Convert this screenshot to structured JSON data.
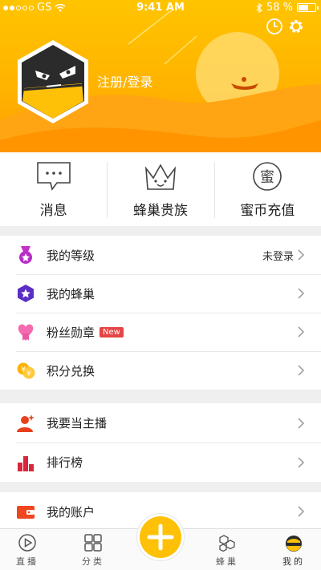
{
  "status_bar": {
    "carrier": "GS",
    "time": "9:41 AM",
    "battery": "58 %",
    "battery_level": 0.58
  },
  "header": {
    "login_label": "注册/登录",
    "icons": [
      "clock-icon",
      "gear-icon"
    ]
  },
  "actions": [
    {
      "label": "消息",
      "icon": "chat-bubble-icon"
    },
    {
      "label": "蜂巢贵族",
      "icon": "crown-icon"
    },
    {
      "label": "蜜币充值",
      "icon": "honey-coin-icon",
      "icon_text": "蜜"
    }
  ],
  "menu_groups": [
    [
      {
        "label": "我的等级",
        "icon": "level-medal-icon",
        "value": "未登录"
      },
      {
        "label": "我的蜂巢",
        "icon": "hive-star-icon"
      },
      {
        "label": "粉丝勋章",
        "icon": "fan-badge-icon",
        "badge": "New"
      },
      {
        "label": "积分兑换",
        "icon": "points-coins-icon",
        "icon_text": "¥"
      }
    ],
    [
      {
        "label": "我要当主播",
        "icon": "streamer-icon"
      },
      {
        "label": "排行榜",
        "icon": "ranking-icon"
      }
    ],
    [
      {
        "label": "我的账户",
        "icon": "wallet-icon"
      }
    ]
  ],
  "tabbar": {
    "tabs": [
      {
        "label": "直播",
        "icon": "live-play-icon"
      },
      {
        "label": "分类",
        "icon": "category-grid-icon"
      },
      {
        "label": "蜂巢",
        "icon": "hive-tab-icon"
      },
      {
        "label": "我的",
        "icon": "profile-bee-icon",
        "active": true
      }
    ],
    "center_icon": "plus-icon"
  },
  "colors": {
    "accent": "#ffc107",
    "header_top": "#ffc400",
    "header_bottom": "#ff9d00",
    "badge_red": "#e64545"
  }
}
